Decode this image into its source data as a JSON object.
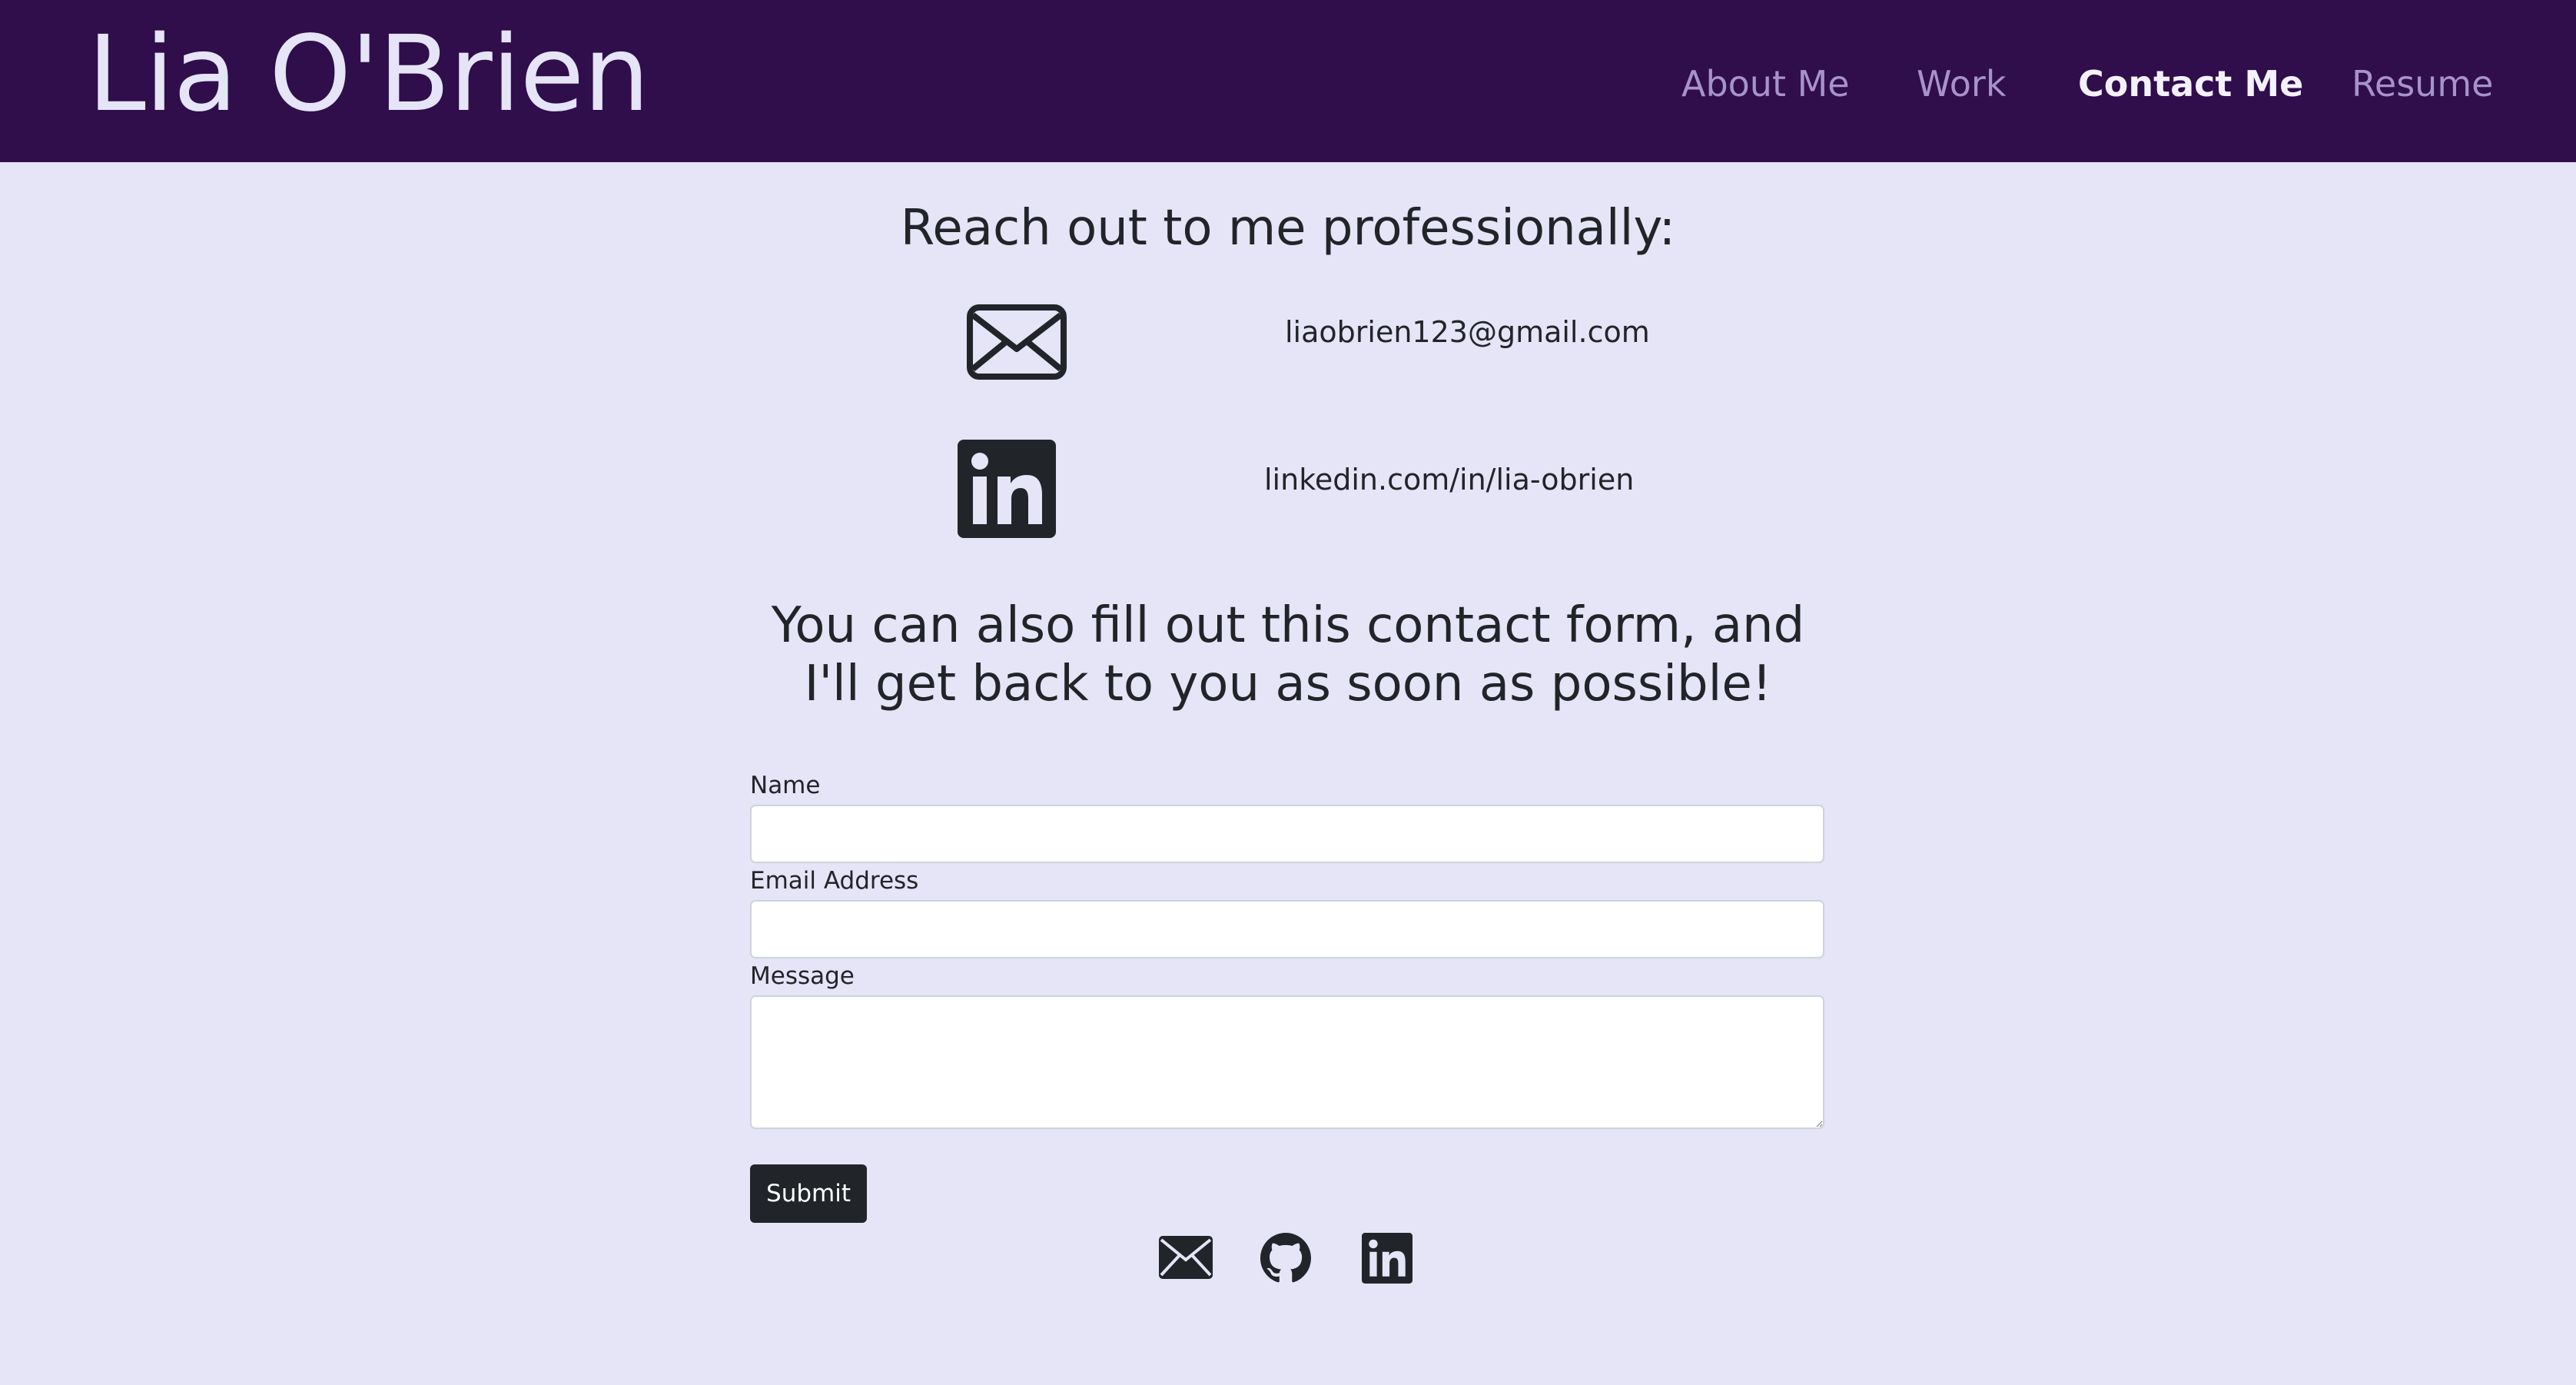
{
  "header": {
    "brand": "Lia O'Brien",
    "nav": [
      {
        "label": "About Me",
        "active": false
      },
      {
        "label": "Work",
        "active": false
      },
      {
        "label": "Contact Me",
        "active": true
      },
      {
        "label": "Resume",
        "active": false
      }
    ]
  },
  "contact": {
    "heading": "Reach out to me professionally:",
    "items": [
      {
        "icon": "envelope-icon",
        "text": "liaobrien123@gmail.com"
      },
      {
        "icon": "linkedin-icon",
        "text": "linkedin.com/in/lia-obrien"
      }
    ]
  },
  "form": {
    "heading": "You can also fill out this contact form, and I'll get back to you as soon as possible!",
    "fields": [
      {
        "label": "Name",
        "value": ""
      },
      {
        "label": "Email Address",
        "value": ""
      },
      {
        "label": "Message",
        "value": ""
      }
    ],
    "submit_label": "Submit"
  },
  "footer": {
    "icons": [
      "envelope-icon",
      "github-icon",
      "linkedin-icon"
    ]
  },
  "colors": {
    "header_bg": "#2f0e4b",
    "page_bg": "#e6e4f7",
    "nav_inactive": "#a792cc",
    "nav_active": "#f4f1ff",
    "text": "#212529"
  }
}
